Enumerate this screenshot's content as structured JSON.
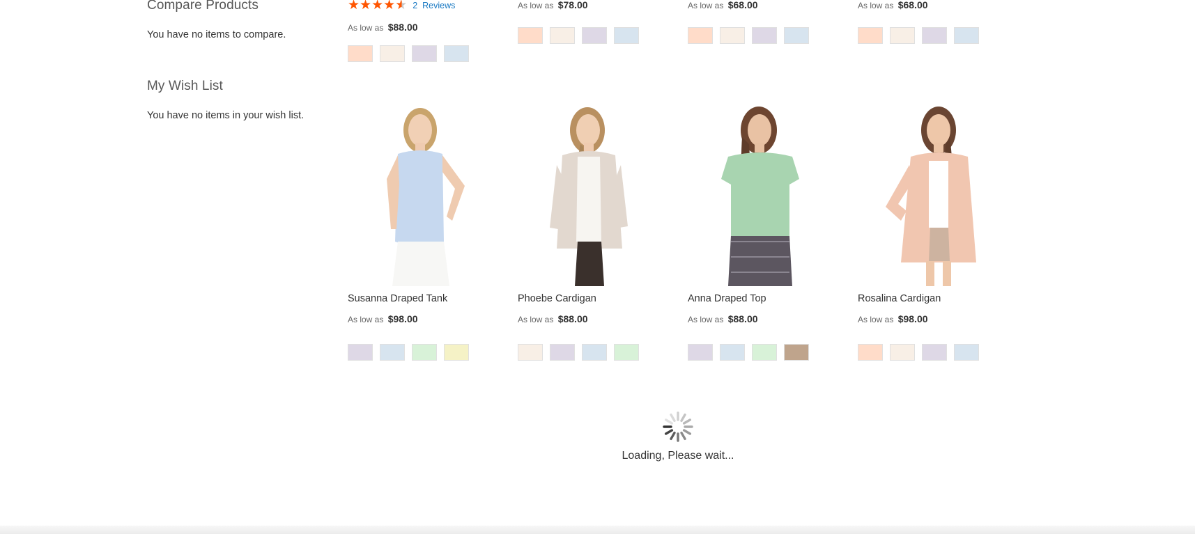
{
  "sidebar": {
    "compare_title": "Compare Products",
    "compare_empty": "You have no items to compare.",
    "wishlist_title": "My Wish List",
    "wishlist_empty": "You have no items in your wish list."
  },
  "top_row": [
    {
      "rating_stars": 4.5,
      "reviews_count": "2",
      "reviews_label": "Reviews",
      "price_prefix": "As low as",
      "price": "$88.00",
      "swatches": [
        "#ffdcc9",
        "#f8efe6",
        "#ded8e6",
        "#d7e4ef"
      ]
    },
    {
      "price_prefix": "As low as",
      "price": "$78.00",
      "swatches": [
        "#ffdcc9",
        "#f8efe6",
        "#ded8e6",
        "#d7e4ef"
      ]
    },
    {
      "price_prefix": "As low as",
      "price": "$68.00",
      "swatches": [
        "#ffdcc9",
        "#f8efe6",
        "#ded8e6",
        "#d7e4ef"
      ]
    },
    {
      "price_prefix": "As low as",
      "price": "$68.00",
      "swatches": [
        "#ffdcc9",
        "#f8efe6",
        "#ded8e6",
        "#d7e4ef"
      ]
    }
  ],
  "products": [
    {
      "name": "Susanna Draped Tank",
      "price_prefix": "As low as",
      "price": "$98.00",
      "swatches": [
        "#ded8e6",
        "#d7e4ef",
        "#d8f2d8",
        "#f5f2c6"
      ],
      "image": "woman-in-blue-draped-tank"
    },
    {
      "name": "Phoebe Cardigan",
      "price_prefix": "As low as",
      "price": "$88.00",
      "swatches": [
        "#f8efe6",
        "#ded8e6",
        "#d7e4ef",
        "#d8f2d8"
      ],
      "image": "woman-in-beige-cardigan"
    },
    {
      "name": "Anna Draped Top",
      "price_prefix": "As low as",
      "price": "$88.00",
      "swatches": [
        "#ded8e6",
        "#d7e4ef",
        "#d8f2d8",
        "#bfa48c"
      ],
      "image": "woman-in-green-top"
    },
    {
      "name": "Rosalina Cardigan",
      "price_prefix": "As low as",
      "price": "$98.00",
      "swatches": [
        "#ffdcc9",
        "#f8efe6",
        "#ded8e6",
        "#d7e4ef"
      ],
      "image": "woman-in-peach-cardigan"
    }
  ],
  "loader": {
    "text": "Loading, Please wait...",
    "icon": "spinner-icon"
  },
  "colors": {
    "star": "#ff5501",
    "link": "#1979c3",
    "text": "#333333"
  }
}
